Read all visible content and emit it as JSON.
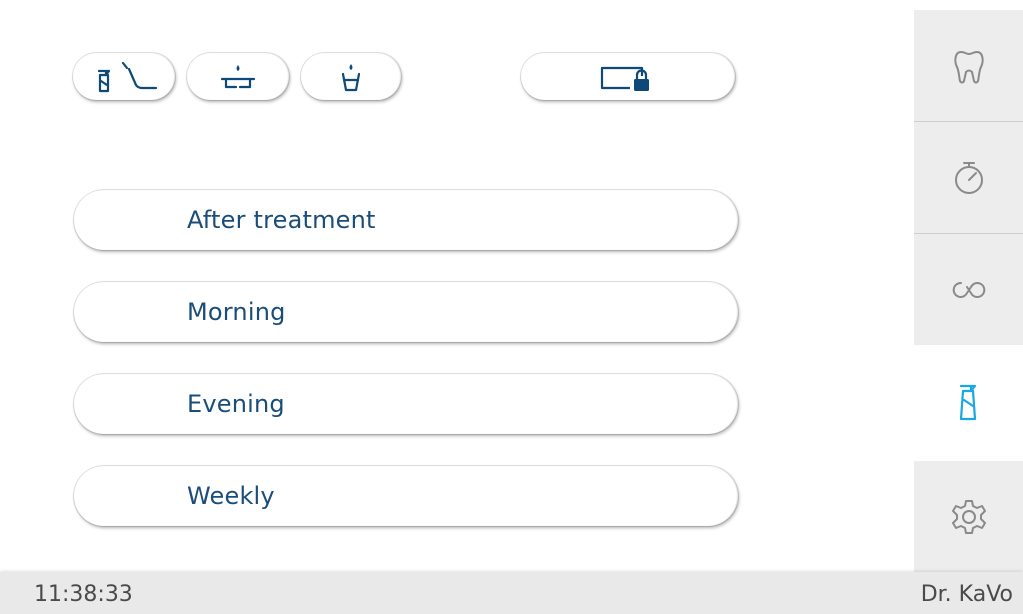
{
  "top_buttons": [
    {
      "name": "chair-spray-program",
      "icon": "spray-chair-icon"
    },
    {
      "name": "basin-cleaning",
      "icon": "basin-drop-icon"
    },
    {
      "name": "cup-filling",
      "icon": "cup-drop-icon"
    },
    {
      "name": "screen-lock",
      "icon": "screen-lock-icon"
    }
  ],
  "menu": {
    "items": [
      {
        "label": "After treatment"
      },
      {
        "label": "Morning"
      },
      {
        "label": "Evening"
      },
      {
        "label": "Weekly"
      }
    ]
  },
  "sidebar": {
    "items": [
      {
        "name": "tooth",
        "icon": "tooth-icon",
        "active": false
      },
      {
        "name": "timer",
        "icon": "stopwatch-icon",
        "active": false
      },
      {
        "name": "hygiene",
        "icon": "infinity-loop-icon",
        "active": false
      },
      {
        "name": "cleaning",
        "icon": "spray-bottle-icon",
        "active": true
      },
      {
        "name": "settings",
        "icon": "gear-icon",
        "active": false
      }
    ]
  },
  "status": {
    "time": "11:38:33",
    "user": "Dr. KaVo"
  },
  "colors": {
    "icon_dark": "#0d4a7a",
    "active_accent": "#1aa8e0",
    "label_text": "#1a4d7a",
    "sidebar_bg": "#ededed",
    "statusbar_bg": "#e9e9e9"
  }
}
